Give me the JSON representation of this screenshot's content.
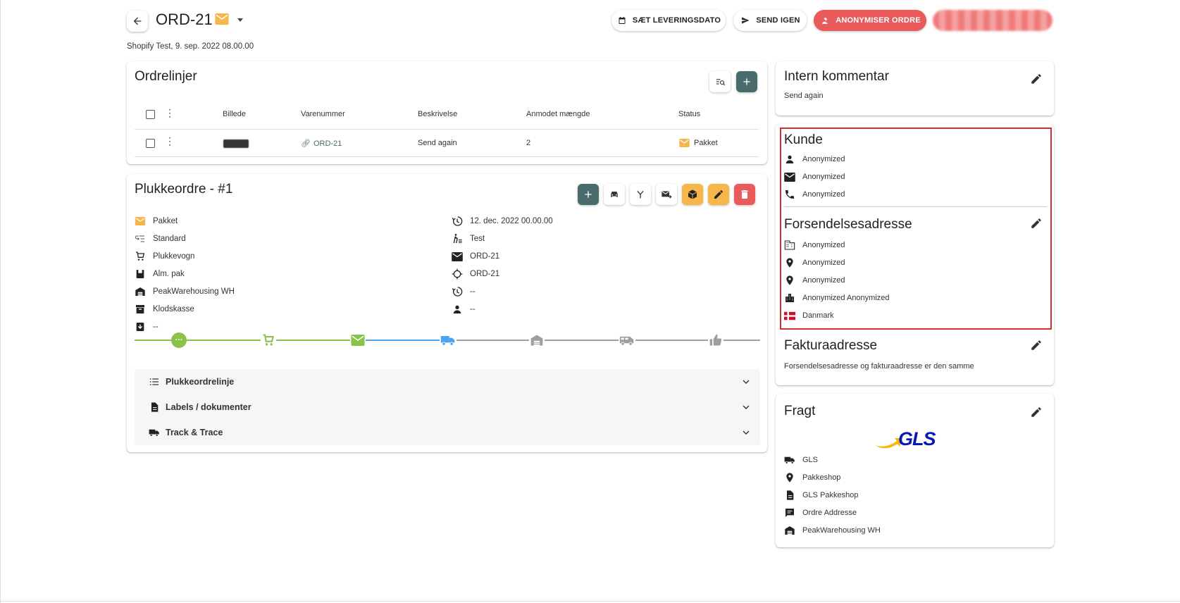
{
  "header": {
    "title": "ORD-21",
    "subtitle": "Shopify Test, 9. sep. 2022 08.00.00",
    "btn_delivery": "SÆT LEVERINGSDATO",
    "btn_send": "SEND IGEN",
    "btn_anon": "ANONYMISER ORDRE"
  },
  "orderlines": {
    "title": "Ordrelinjer",
    "columns": [
      "Billede",
      "Varenummer",
      "Beskrivelse",
      "Anmodet mængde",
      "Status"
    ],
    "rows": [
      {
        "sku": "ORD-21",
        "description": "Send again",
        "qty": "2",
        "status": "Pakket"
      }
    ]
  },
  "pick": {
    "title": "Plukkeordre - #1",
    "left": [
      {
        "icon": "envelope-icon",
        "text": "Pakket"
      },
      {
        "icon": "priority-list-icon",
        "text": "Standard"
      },
      {
        "icon": "cart-icon",
        "text": "Plukkevogn"
      },
      {
        "icon": "package-icon",
        "text": "Alm. pak"
      },
      {
        "icon": "warehouse-icon",
        "text": "PeakWarehousing WH"
      },
      {
        "icon": "archive-icon",
        "text": "Klodskasse"
      },
      {
        "icon": "archive-down-icon",
        "text": "--"
      }
    ],
    "right": [
      {
        "icon": "history-icon",
        "text": "12. dec. 2022 00.00.00"
      },
      {
        "icon": "walker-icon",
        "text": "Test"
      },
      {
        "icon": "envelope-icon",
        "text": "ORD-21"
      },
      {
        "icon": "crosshair-icon",
        "text": "ORD-21"
      },
      {
        "icon": "history-icon",
        "text": "--"
      },
      {
        "icon": "person-icon",
        "text": "--"
      }
    ],
    "accordion": [
      "Plukkeordrelinje",
      "Labels / dokumenter",
      "Track & Trace"
    ]
  },
  "comment": {
    "title": "Intern kommentar",
    "text": "Send again"
  },
  "customer": {
    "title": "Kunde",
    "name": "Anonymized",
    "email": "Anonymized",
    "phone": "Anonymized"
  },
  "shipping": {
    "title": "Forsendelsesadresse",
    "lines": [
      "Anonymized",
      "Anonymized",
      "Anonymized",
      "Anonymized Anonymized"
    ],
    "country": "Danmark"
  },
  "billing": {
    "title": "Fakturaadresse",
    "text": "Forsendelsesadresse og fakturaadresse er den samme"
  },
  "freight": {
    "title": "Fragt",
    "logo": "GLS",
    "lines": [
      {
        "icon": "truck-icon",
        "text": "GLS"
      },
      {
        "icon": "location-pin-icon",
        "text": "Pakkeshop"
      },
      {
        "icon": "document-icon",
        "text": "GLS Pakkeshop"
      },
      {
        "icon": "comment-icon",
        "text": "Ordre Addresse"
      },
      {
        "icon": "warehouse-icon",
        "text": "PeakWarehousing WH"
      }
    ]
  },
  "colors": {
    "teal": "#4a6b6b",
    "orange": "#f7b64a",
    "red": "#e95a5a",
    "green": "#8bc34a",
    "blue": "#4aa3f0",
    "highlight": "#d32f2f"
  }
}
